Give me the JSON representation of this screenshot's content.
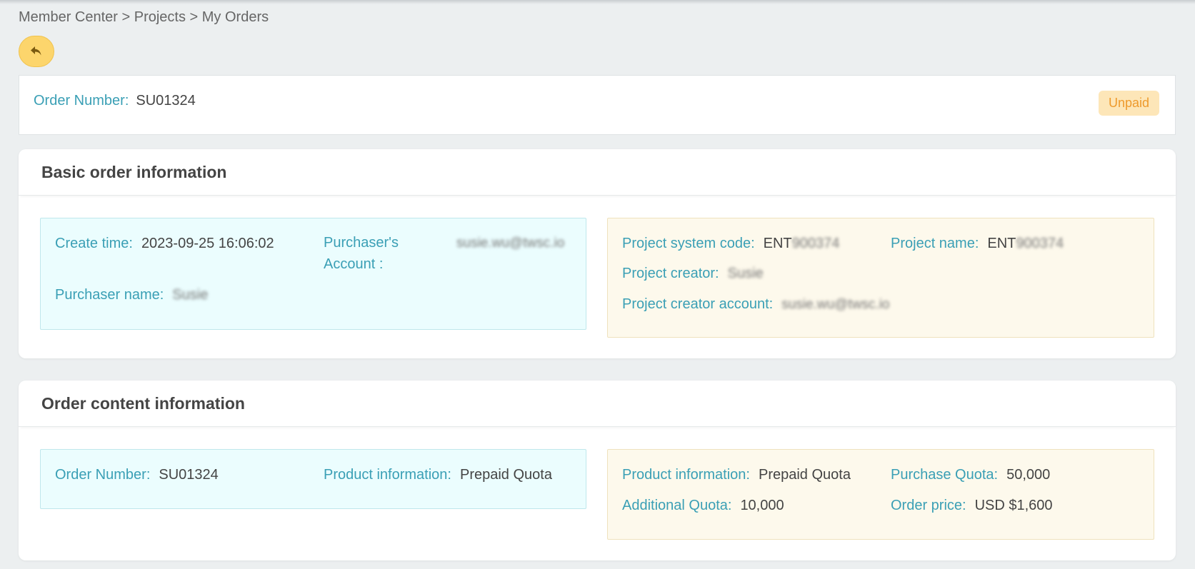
{
  "breadcrumb": "Member Center > Projects > My Orders",
  "back_icon": "undo-arrow-icon",
  "order_bar": {
    "label": "Order Number:",
    "value": "SU01324",
    "status": "Unpaid"
  },
  "basic_info": {
    "title": "Basic order information",
    "left": {
      "create_time_label": "Create time:",
      "create_time_value": "2023-09-25 16:06:02",
      "purchaser_account_label_1": "Purchaser's",
      "purchaser_account_label_2": "Account :",
      "purchaser_account_value": "susie.wu@twsc.io",
      "purchaser_name_label": "Purchaser name:",
      "purchaser_name_value": "Susie"
    },
    "right": {
      "system_code_label": "Project system code:",
      "system_code_prefix": "ENT",
      "system_code_rest": "900374",
      "project_name_label": "Project name:",
      "project_name_prefix": "ENT",
      "project_name_rest": "900374",
      "creator_label": "Project creator:",
      "creator_value": "Susie",
      "creator_account_label": "Project creator account:",
      "creator_account_value": "susie.wu@twsc.io"
    }
  },
  "content_info": {
    "title": "Order content information",
    "left": {
      "order_number_label": "Order Number:",
      "order_number_value": "SU01324",
      "product_info_label": "Product information:",
      "product_info_value": "Prepaid Quota"
    },
    "right": {
      "product_info_label": "Product information:",
      "product_info_value": "Prepaid Quota",
      "purchase_quota_label": "Purchase Quota:",
      "purchase_quota_value": "50,000",
      "additional_quota_label": "Additional Quota:",
      "additional_quota_value": "10,000",
      "order_price_label": "Order price:",
      "order_price_value": "USD $1,600"
    }
  }
}
